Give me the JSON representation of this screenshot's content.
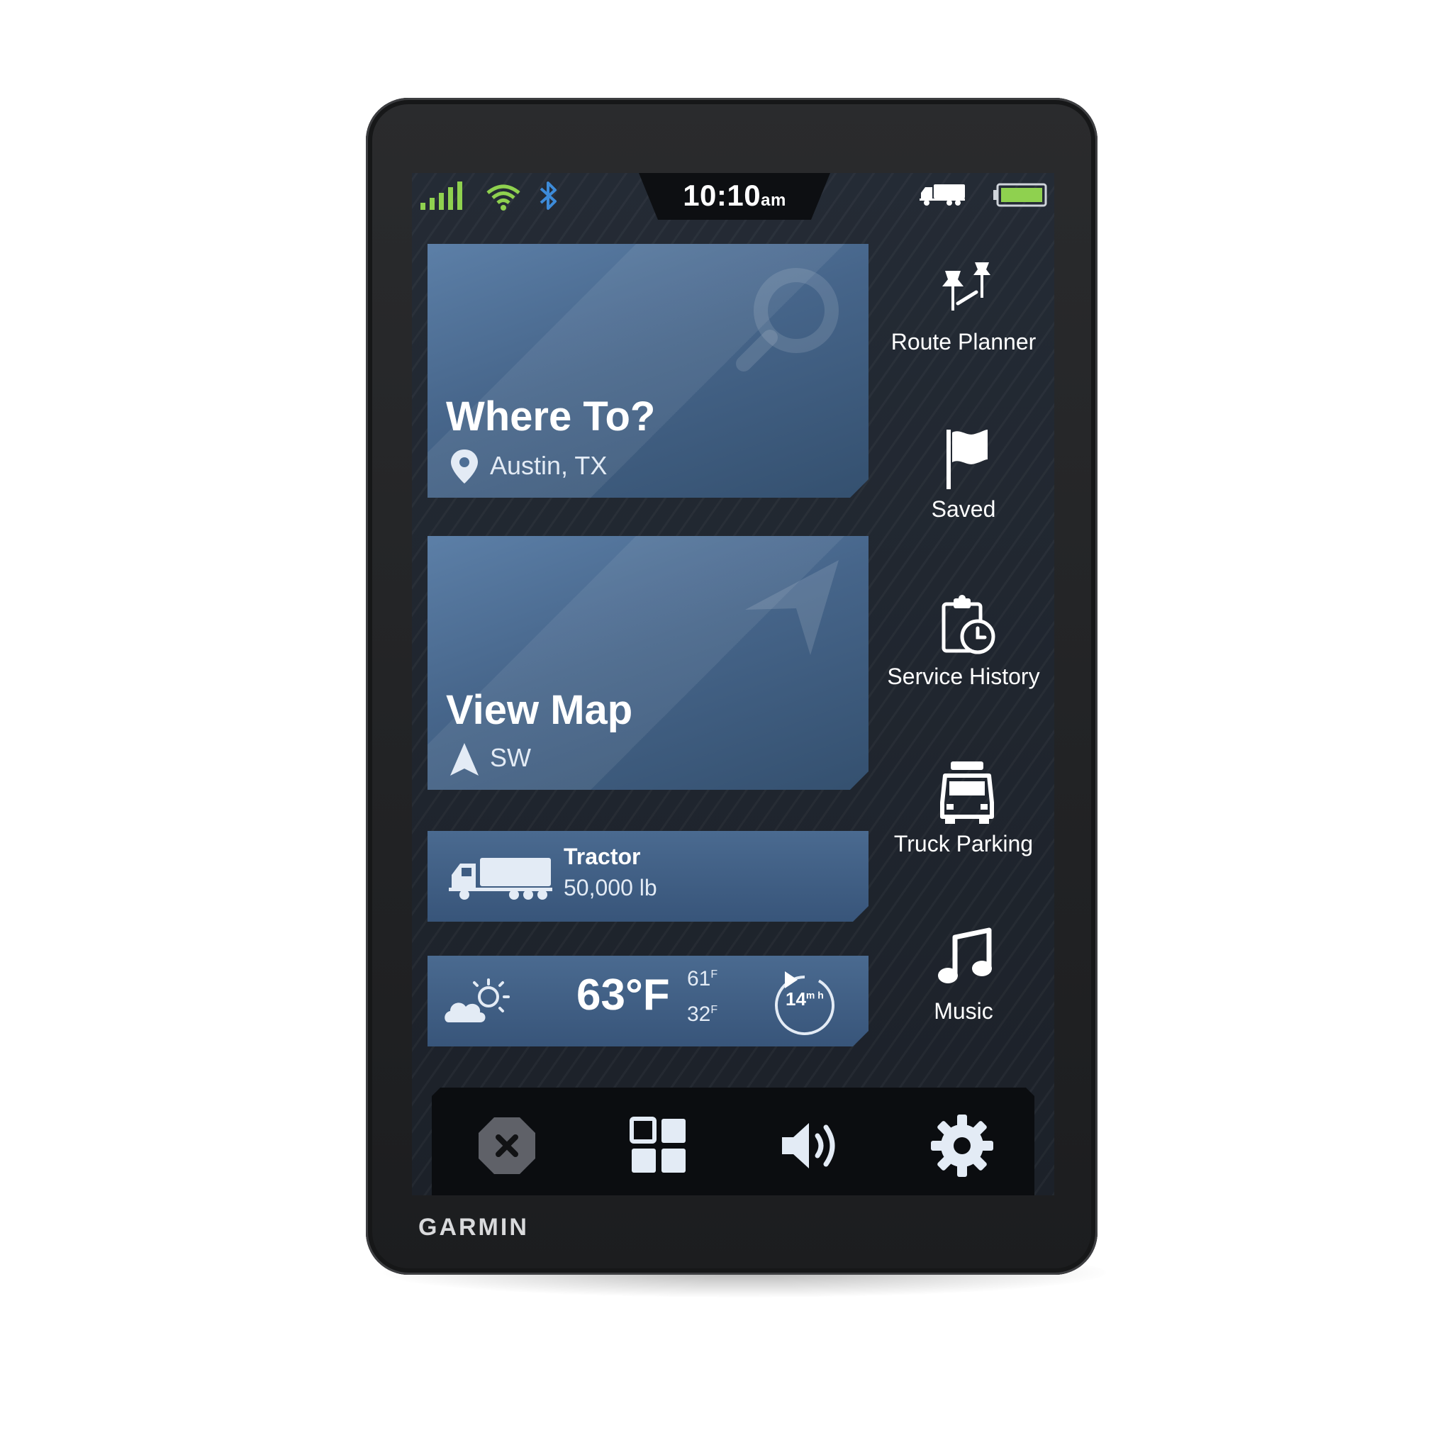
{
  "status_bar": {
    "time": "10:10",
    "time_suffix": "am",
    "icons": [
      "signal-icon",
      "wifi-icon",
      "bluetooth-icon",
      "truck-icon",
      "battery-icon"
    ]
  },
  "cards": {
    "where_to": {
      "title": "Where To?",
      "location": "Austin, TX",
      "icons": [
        "search-icon",
        "location-pin-icon"
      ]
    },
    "view_map": {
      "title": "View Map",
      "heading": "SW",
      "icons": [
        "navigation-arrow-icon"
      ]
    },
    "vehicle": {
      "name": "Tractor",
      "weight": "50,000 lb",
      "icon": "truck-icon"
    },
    "weather": {
      "temp": "63°F",
      "high": "61",
      "low": "32",
      "unit": "F",
      "wind": "14",
      "wind_unit": "m h",
      "icon": "partly-cloudy-icon"
    }
  },
  "menu": {
    "items": [
      {
        "label": "Route Planner",
        "icon": "route-planner-icon"
      },
      {
        "label": "Saved",
        "icon": "flag-icon"
      },
      {
        "label": "Service History",
        "icon": "service-history-icon"
      },
      {
        "label": "Truck Parking",
        "icon": "truck-parking-icon"
      },
      {
        "label": "Music",
        "icon": "music-note-icon"
      }
    ]
  },
  "dock": {
    "buttons": [
      {
        "name": "close-button",
        "icon": "close-icon"
      },
      {
        "name": "apps-button",
        "icon": "grid-icon"
      },
      {
        "name": "volume-button",
        "icon": "volume-icon"
      },
      {
        "name": "settings-button",
        "icon": "gear-icon"
      }
    ]
  },
  "brand": "GARMIN",
  "colors": {
    "accent_green": "#8fd14f",
    "bluetooth_blue": "#3d8bd9",
    "card_blue": "#4a6a90",
    "screen_bg": "#20262f"
  }
}
